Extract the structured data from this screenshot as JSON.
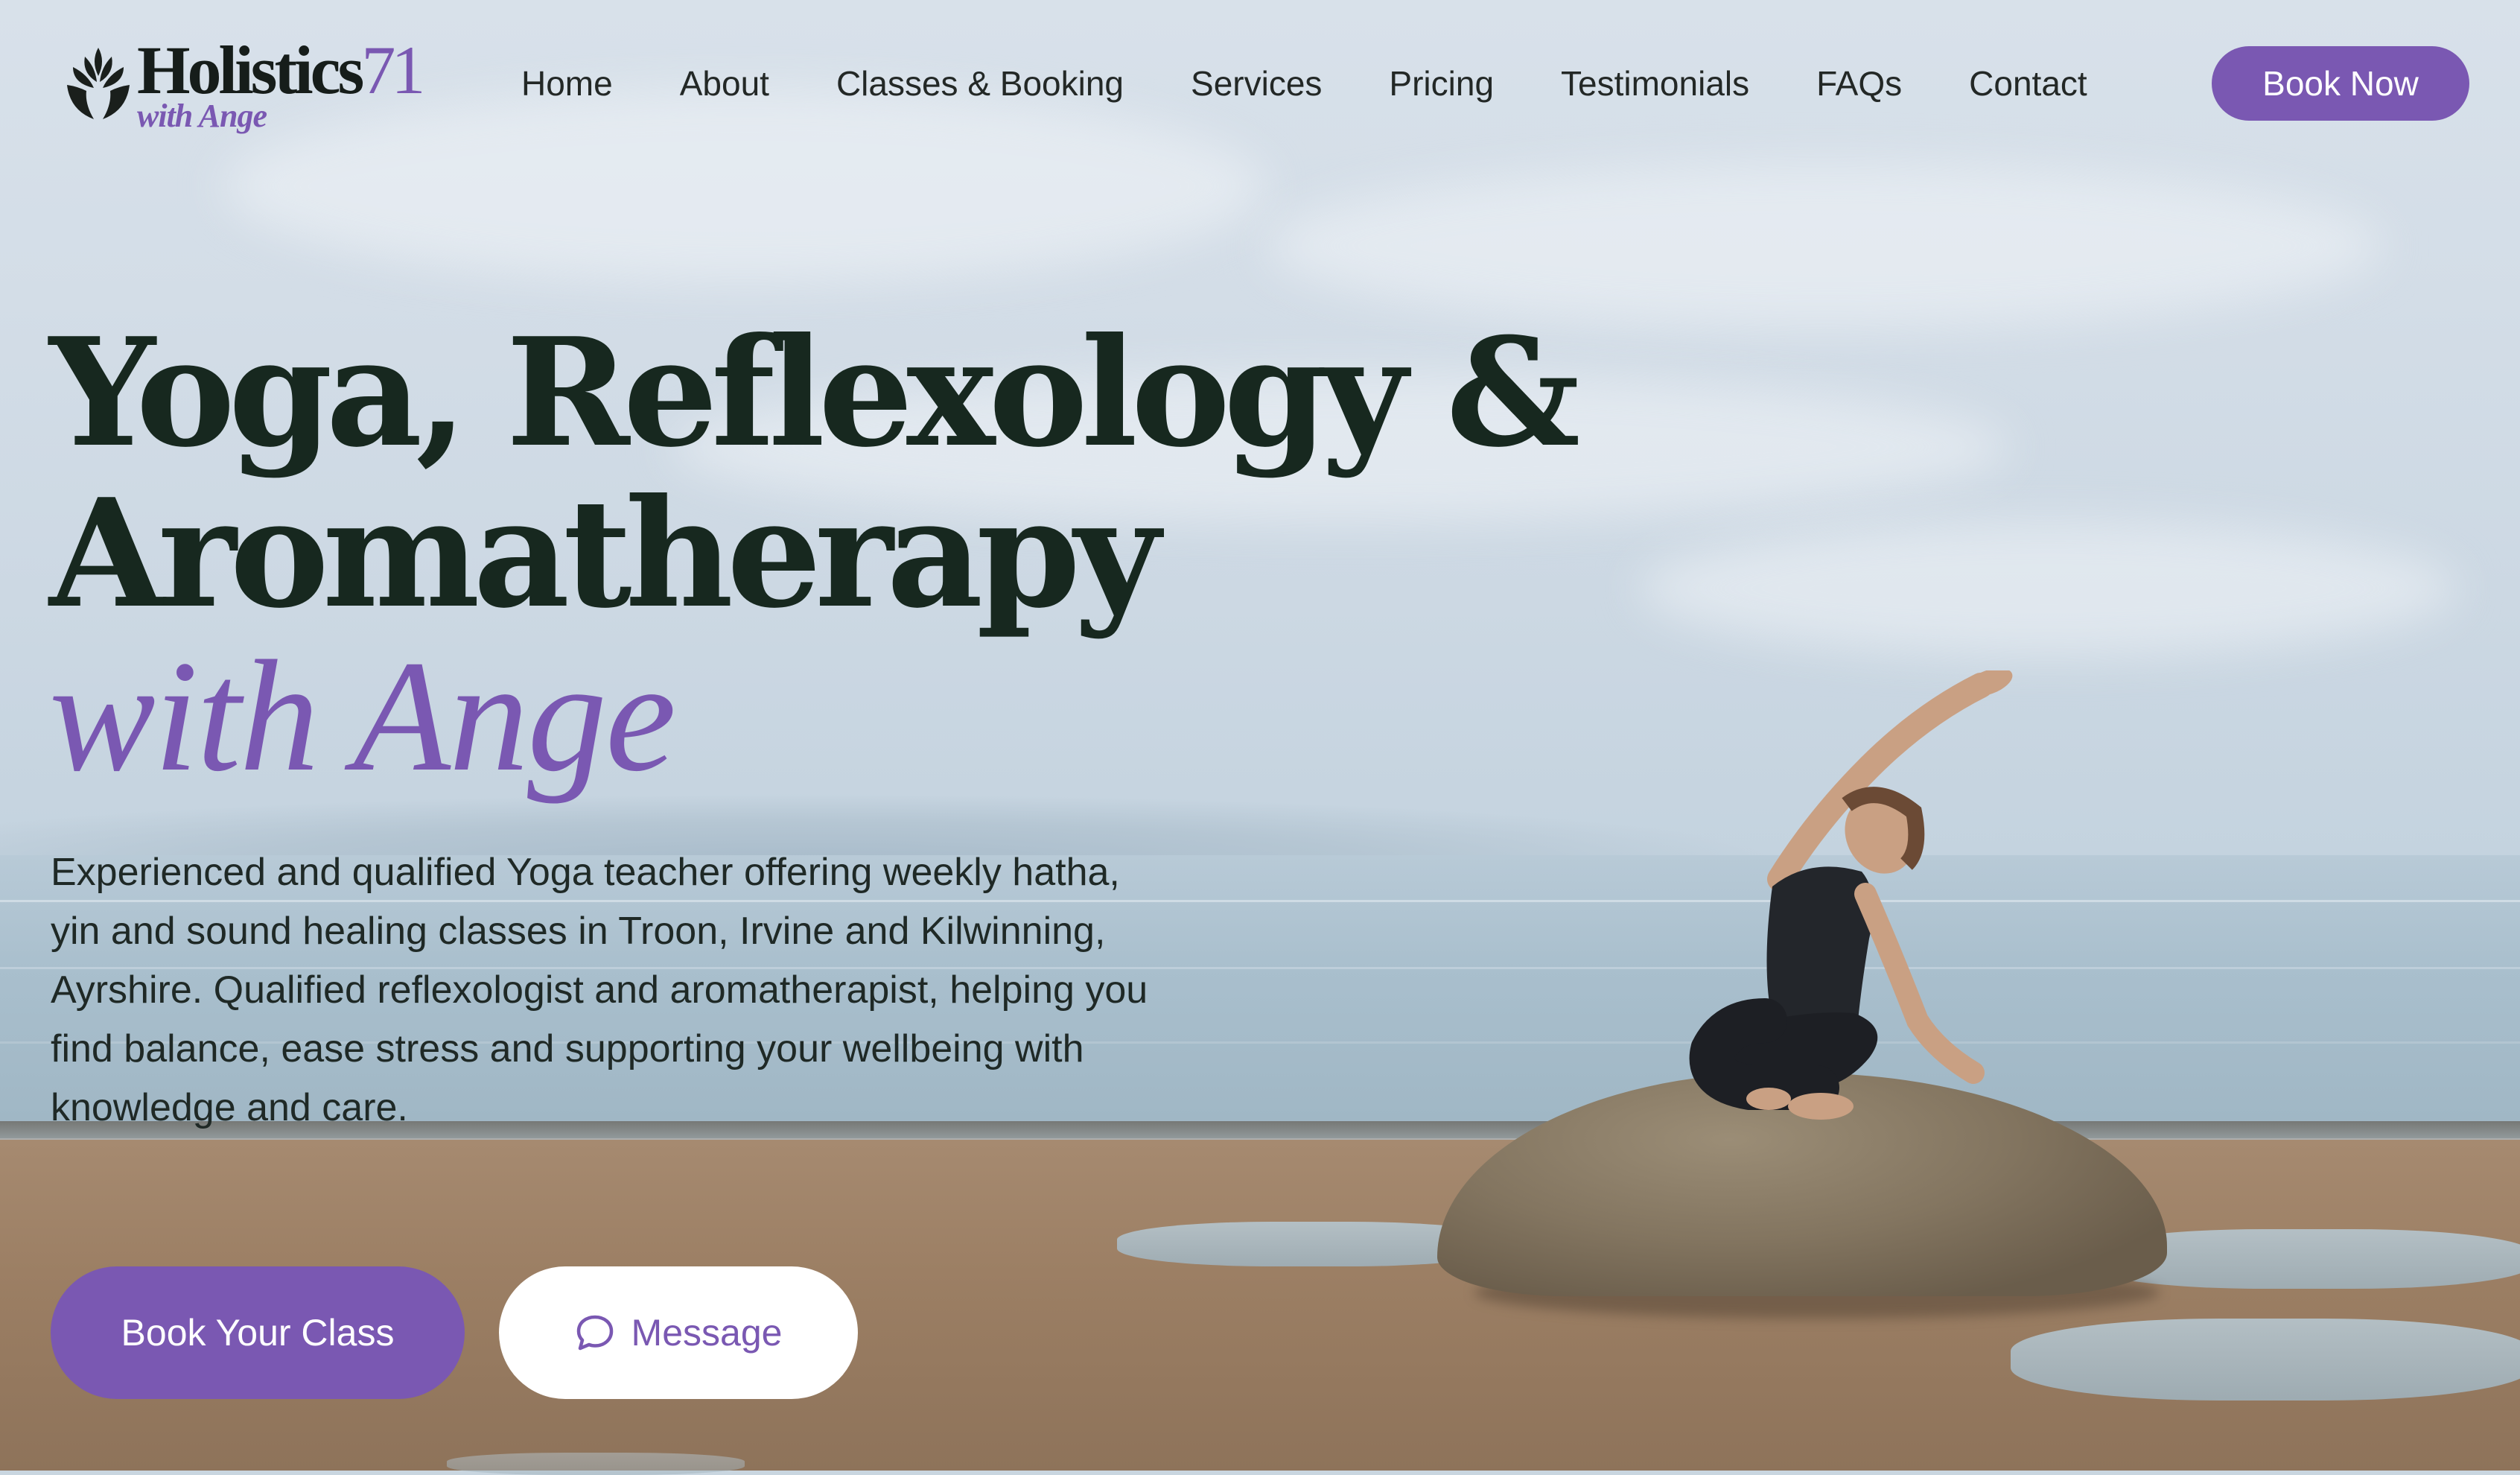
{
  "colors": {
    "accent": "#7a58b2",
    "heading": "#17281f",
    "text": "#1f2926",
    "button_text": "#ffffff"
  },
  "header": {
    "logo": {
      "name": "Holistics",
      "number": "71",
      "subtitle": "with Ange",
      "icon": "lotus-hands-icon"
    },
    "nav": [
      {
        "label": "Home"
      },
      {
        "label": "About"
      },
      {
        "label": "Classes & Booking"
      },
      {
        "label": "Services"
      },
      {
        "label": "Pricing"
      },
      {
        "label": "Testimonials"
      },
      {
        "label": "FAQs"
      },
      {
        "label": "Contact"
      }
    ],
    "book_now_label": "Book Now"
  },
  "hero": {
    "title_line1": "Yoga, Reflexology &",
    "title_line2": "Aromatherapy",
    "tagline": "with Ange",
    "description": "Experienced and qualified Yoga teacher offering weekly hatha, yin and sound healing classes in Troon, Irvine and Kilwinning, Ayrshire. Qualified reflexologist and aromatherapist, helping you find balance, ease stress and supporting your wellbeing with knowledge and care.",
    "primary_button": "Book Your Class",
    "secondary_button": "Message",
    "secondary_button_icon": "chat-bubble-icon"
  }
}
